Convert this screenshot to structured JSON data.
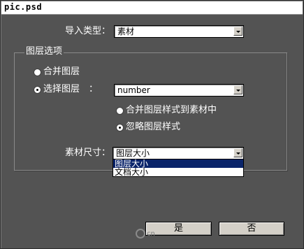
{
  "window": {
    "title": "pic.psd"
  },
  "import_type": {
    "label": "导入类型：",
    "value": "素材"
  },
  "layer_options": {
    "legend": "图层选项",
    "merge_layers_label": "合并图层",
    "merge_layers_selected": false,
    "select_layer_label": "选择图层　：",
    "select_layer_selected": true,
    "select_layer_value": "number",
    "merge_styles_label": "合并图层样式到素材中",
    "merge_styles_selected": false,
    "ignore_styles_label": "忽略图层样式",
    "ignore_styles_selected": true
  },
  "footage_size": {
    "label": "素材尺寸：",
    "value": "图层大小",
    "options": [
      "图层大小",
      "文档大小"
    ],
    "highlighted_option": "图层大小"
  },
  "buttons": {
    "ok": "是",
    "cancel": "否"
  },
  "watermark": "cn"
}
